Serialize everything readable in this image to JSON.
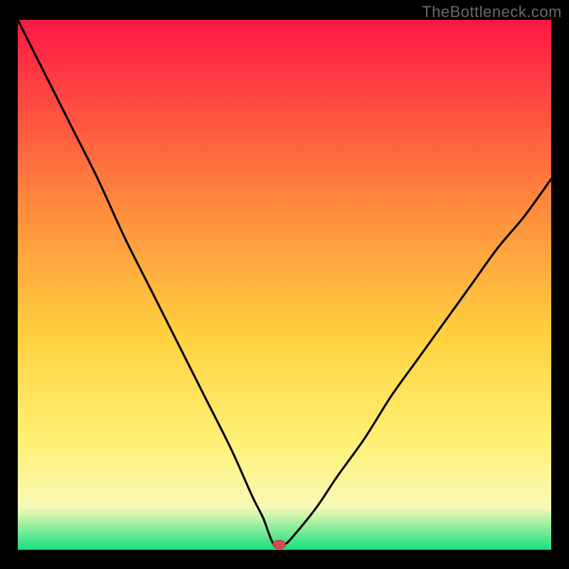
{
  "watermark": "TheBottleneck.com",
  "colors": {
    "bg": "#000000",
    "watermark": "#6a6a6a",
    "curve": "#000000",
    "marker_fill": "#d94a4a",
    "marker_stroke": "#b23a3a",
    "gradient_top": "#ff1744",
    "gradient_mid1": "#ff8a3d",
    "gradient_mid2": "#ffd23f",
    "gradient_mid3": "#fff176",
    "gradient_band": "#f7f9b8",
    "gradient_bottom": "#18e07f"
  },
  "chart_data": {
    "type": "line",
    "title": "",
    "xlabel": "",
    "ylabel": "",
    "xlim": [
      0,
      100
    ],
    "ylim": [
      0,
      100
    ],
    "notch_x": 48,
    "marker": {
      "x": 49,
      "y": 1
    },
    "series": [
      {
        "name": "bottleneck-curve",
        "x": [
          0,
          5,
          10,
          15,
          20,
          25,
          30,
          35,
          40,
          44,
          46,
          48,
          50,
          52,
          56,
          60,
          65,
          70,
          75,
          80,
          85,
          90,
          95,
          100
        ],
        "values": [
          100,
          90,
          80,
          70,
          59,
          49,
          39,
          29,
          19,
          10,
          6,
          1,
          1,
          3,
          8,
          14,
          21,
          29,
          36,
          43,
          50,
          57,
          63,
          70
        ]
      }
    ]
  }
}
